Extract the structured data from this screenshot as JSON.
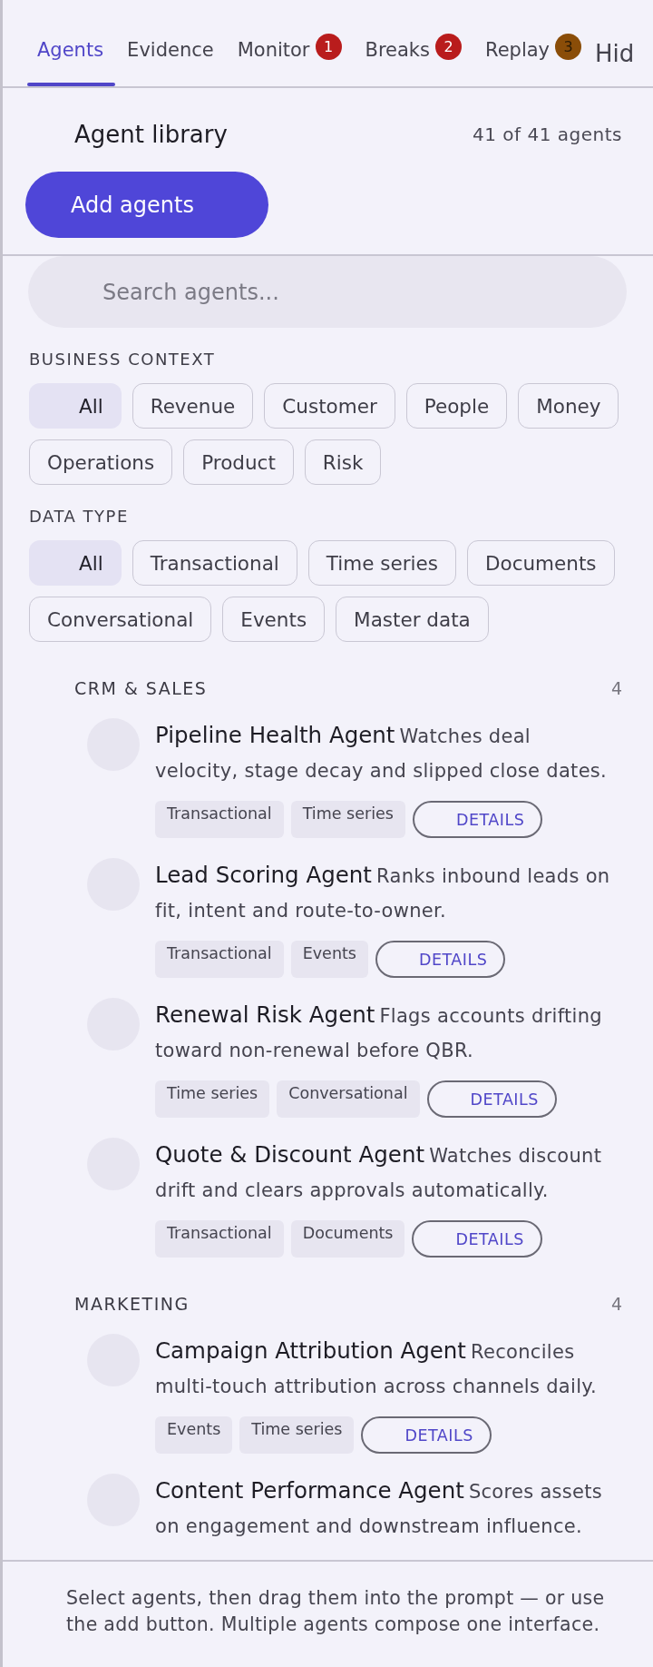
{
  "tabs": [
    {
      "label": "Agents",
      "selected": true
    },
    {
      "label": "Evidence",
      "selected": false
    },
    {
      "label": "Monitor",
      "selected": false,
      "badge": {
        "text": "1",
        "color": "#b91c1c"
      }
    },
    {
      "label": "Breaks",
      "selected": false,
      "badge": {
        "text": "2",
        "color": "#b91c1c"
      }
    },
    {
      "label": "Replay",
      "selected": false,
      "badge": {
        "text": "3",
        "color": "#8a4d08"
      }
    }
  ],
  "hide_link": "Hid",
  "header": {
    "title": "Agent library",
    "count": "41 of 41 agents",
    "add_button": "Add agents"
  },
  "search": {
    "placeholder": "Search agents..."
  },
  "filters": [
    {
      "label": "BUSINESS CONTEXT",
      "chips": [
        {
          "label": "All",
          "selected": true
        },
        {
          "label": "Revenue",
          "selected": false
        },
        {
          "label": "Customer",
          "selected": false
        },
        {
          "label": "People",
          "selected": false
        },
        {
          "label": "Money",
          "selected": false
        },
        {
          "label": "Operations",
          "selected": false
        },
        {
          "label": "Product",
          "selected": false
        },
        {
          "label": "Risk",
          "selected": false
        }
      ]
    },
    {
      "label": "DATA TYPE",
      "chips": [
        {
          "label": "All",
          "selected": true
        },
        {
          "label": "Transactional",
          "selected": false
        },
        {
          "label": "Time series",
          "selected": false
        },
        {
          "label": "Documents",
          "selected": false
        },
        {
          "label": "Conversational",
          "selected": false
        },
        {
          "label": "Events",
          "selected": false
        },
        {
          "label": "Master data",
          "selected": false
        }
      ]
    }
  ],
  "groups": [
    {
      "title": "CRM & SALES",
      "count": "4",
      "agents": [
        {
          "name": "Pipeline Health Agent",
          "description": "Watches deal velocity, stage decay and slipped close dates.",
          "tags": [
            "Transactional",
            "Time series"
          ],
          "button": "DETAILS"
        },
        {
          "name": "Lead Scoring Agent",
          "description": "Ranks inbound leads on fit, intent and route-to-owner.",
          "tags": [
            "Transactional",
            "Events"
          ],
          "button": "DETAILS"
        },
        {
          "name": "Renewal Risk Agent",
          "description": "Flags accounts drifting toward non-renewal before QBR.",
          "tags": [
            "Time series",
            "Conversational"
          ],
          "button": "DETAILS"
        },
        {
          "name": "Quote & Discount Agent",
          "description": "Watches discount drift and clears approvals automatically.",
          "tags": [
            "Transactional",
            "Documents"
          ],
          "button": "DETAILS"
        }
      ]
    },
    {
      "title": "MARKETING",
      "count": "4",
      "agents": [
        {
          "name": "Campaign Attribution Agent",
          "description": "Reconciles multi-touch attribution across channels daily.",
          "tags": [
            "Events",
            "Time series"
          ],
          "button": "DETAILS"
        },
        {
          "name": "Content Performance Agent",
          "description": "Scores assets on engagement and downstream influence."
        }
      ]
    }
  ],
  "footer": "Select agents, then drag them into the prompt — or use the add button. Multiple agents compose one interface."
}
